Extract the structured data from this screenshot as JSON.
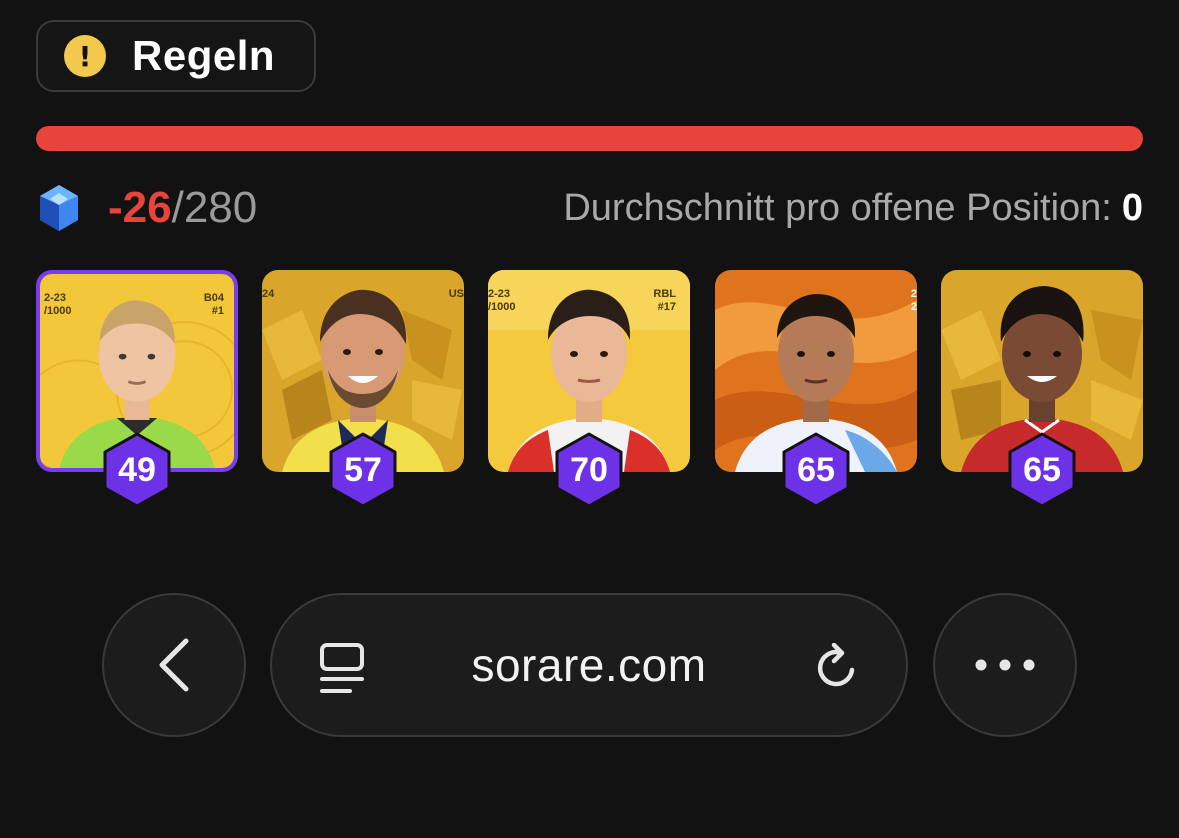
{
  "rules": {
    "label": "Regeln",
    "icon": "warning-icon"
  },
  "progress": {
    "fill_fraction": 1.0,
    "color": "#e8443a"
  },
  "score": {
    "icon": "gem-icon",
    "current": "-26",
    "separator": "/",
    "cap": "280",
    "average_label": "Durchschnitt pro offene Position:",
    "average_value": "0"
  },
  "cards": [
    {
      "score": "49",
      "selected": true,
      "top_left": "2-23\n/1000",
      "top_right": "B04\n#1"
    },
    {
      "score": "57",
      "selected": false,
      "top_left": "24",
      "top_right": "US"
    },
    {
      "score": "70",
      "selected": false,
      "top_left": "2-23\n/1000",
      "top_right": "RBL\n#17"
    },
    {
      "score": "65",
      "selected": false,
      "top_left": "",
      "top_right": "2\n2"
    },
    {
      "score": "65",
      "selected": false,
      "top_left": "",
      "top_right": ""
    }
  ],
  "browser": {
    "back_icon": "chevron-left-icon",
    "page_icon": "reader-icon",
    "url": "sorare.com",
    "reload_icon": "reload-icon",
    "more_icon": "more-icon"
  },
  "colors": {
    "accent_purple": "#6d32e8",
    "negative_red": "#e8443a",
    "gold": "#f1c62c"
  }
}
